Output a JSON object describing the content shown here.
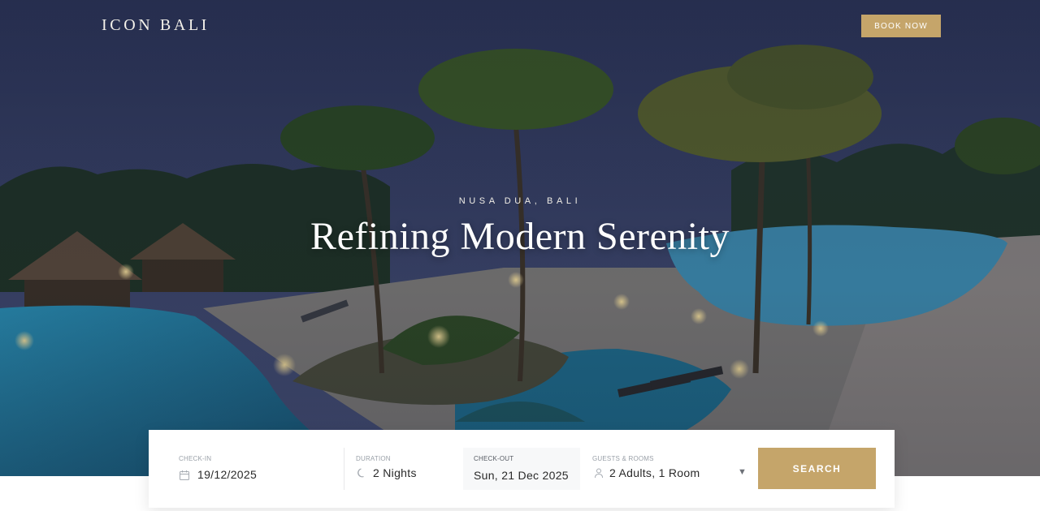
{
  "header": {
    "brand": "ICON BALI",
    "book_now_label": "BOOK NOW"
  },
  "hero": {
    "location": "NUSA DUA, BALI",
    "headline": "Refining Modern Serenity"
  },
  "booking": {
    "checkin": {
      "label": "CHECK-IN",
      "value": "19/12/2025",
      "icon": "calendar-icon"
    },
    "duration": {
      "label": "DURATION",
      "value": "2 Nights",
      "icon": "moon-icon"
    },
    "checkout": {
      "label": "CHECK-OUT",
      "value": "Sun, 21 Dec 2025"
    },
    "guests": {
      "label": "GUESTS & ROOMS",
      "value": "2 Adults, 1 Room",
      "icon": "person-icon"
    },
    "search_label": "SEARCH"
  },
  "colors": {
    "accent": "#c5a56a",
    "hero_dark": "#2b3556"
  }
}
